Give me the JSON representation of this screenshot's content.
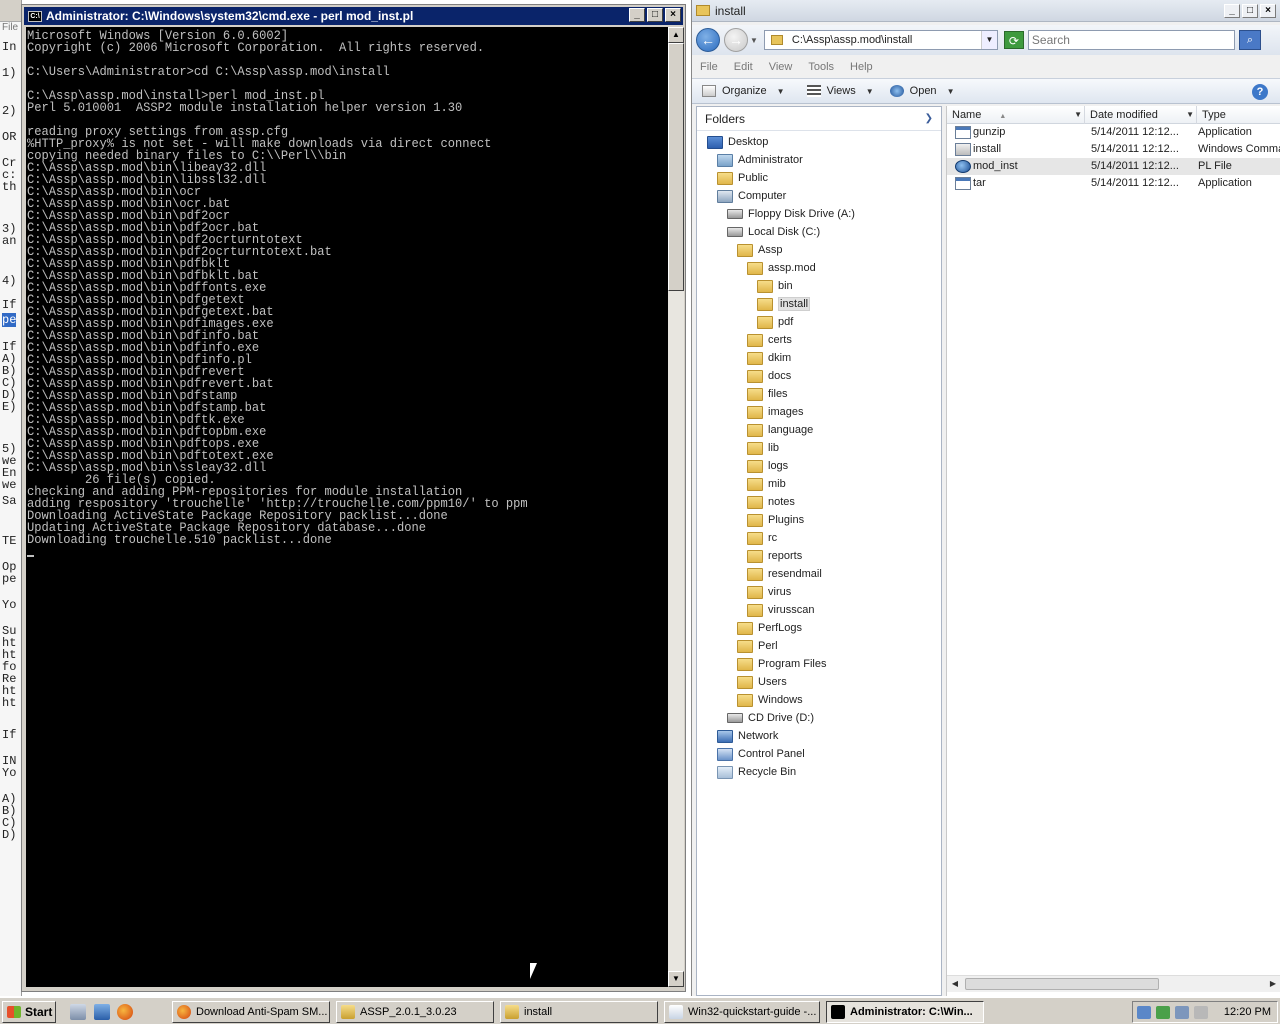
{
  "background_window": {
    "fragments": [
      "File",
      "In",
      "1)",
      "2)",
      "OR",
      "Cr",
      "c:",
      "th",
      "3)",
      "an",
      "4)",
      "If",
      "pe",
      "If",
      "A)",
      "B)",
      "C)",
      "D)",
      "E)",
      "5)",
      "we",
      "En",
      "we",
      "Sa",
      "TE",
      "Op",
      "pe",
      "Yo",
      "Su",
      "ht",
      "ht",
      "fo",
      "Re",
      "ht",
      "ht",
      "If",
      "IN",
      "Yo",
      "A)",
      "B)",
      "C)",
      "D)"
    ]
  },
  "cmd": {
    "title": "Administrator: C:\\Windows\\system32\\cmd.exe - perl  mod_inst.pl",
    "icon": "C:\\",
    "lines": [
      "Microsoft Windows [Version 6.0.6002]",
      "Copyright (c) 2006 Microsoft Corporation.  All rights reserved.",
      "",
      "C:\\Users\\Administrator>cd C:\\Assp\\assp.mod\\install",
      "",
      "C:\\Assp\\assp.mod\\install>perl mod_inst.pl",
      "Perl 5.010001  ASSP2 module installation helper version 1.30",
      "",
      "reading proxy settings from assp.cfg",
      "%HTTP_proxy% is not set - will make downloads via direct connect",
      "copying needed binary files to C:\\\\Perl\\\\bin",
      "C:\\Assp\\assp.mod\\bin\\libeay32.dll",
      "C:\\Assp\\assp.mod\\bin\\libssl32.dll",
      "C:\\Assp\\assp.mod\\bin\\ocr",
      "C:\\Assp\\assp.mod\\bin\\ocr.bat",
      "C:\\Assp\\assp.mod\\bin\\pdf2ocr",
      "C:\\Assp\\assp.mod\\bin\\pdf2ocr.bat",
      "C:\\Assp\\assp.mod\\bin\\pdf2ocrturntotext",
      "C:\\Assp\\assp.mod\\bin\\pdf2ocrturntotext.bat",
      "C:\\Assp\\assp.mod\\bin\\pdfbklt",
      "C:\\Assp\\assp.mod\\bin\\pdfbklt.bat",
      "C:\\Assp\\assp.mod\\bin\\pdffonts.exe",
      "C:\\Assp\\assp.mod\\bin\\pdfgetext",
      "C:\\Assp\\assp.mod\\bin\\pdfgetext.bat",
      "C:\\Assp\\assp.mod\\bin\\pdfimages.exe",
      "C:\\Assp\\assp.mod\\bin\\pdfinfo.bat",
      "C:\\Assp\\assp.mod\\bin\\pdfinfo.exe",
      "C:\\Assp\\assp.mod\\bin\\pdfinfo.pl",
      "C:\\Assp\\assp.mod\\bin\\pdfrevert",
      "C:\\Assp\\assp.mod\\bin\\pdfrevert.bat",
      "C:\\Assp\\assp.mod\\bin\\pdfstamp",
      "C:\\Assp\\assp.mod\\bin\\pdfstamp.bat",
      "C:\\Assp\\assp.mod\\bin\\pdftk.exe",
      "C:\\Assp\\assp.mod\\bin\\pdftopbm.exe",
      "C:\\Assp\\assp.mod\\bin\\pdftops.exe",
      "C:\\Assp\\assp.mod\\bin\\pdftotext.exe",
      "C:\\Assp\\assp.mod\\bin\\ssleay32.dll",
      "        26 file(s) copied.",
      "checking and adding PPM-repositories for module installation",
      "adding respository 'trouchelle' 'http://trouchelle.com/ppm10/' to ppm",
      "Downloading ActiveState Package Repository packlist...done",
      "Updating ActiveState Package Repository database...done",
      "Downloading trouchelle.510 packlist...done"
    ]
  },
  "explorer": {
    "title": "install",
    "address": "C:\\Assp\\assp.mod\\install",
    "search_placeholder": "Search",
    "menu": [
      "File",
      "Edit",
      "View",
      "Tools",
      "Help"
    ],
    "toolbar": {
      "organize": "Organize",
      "views": "Views",
      "open": "Open"
    },
    "folders_header": "Folders",
    "tree": [
      {
        "label": "Desktop",
        "icon": "desktop",
        "depth": 0
      },
      {
        "label": "Administrator",
        "icon": "user",
        "depth": 1
      },
      {
        "label": "Public",
        "icon": "folder",
        "depth": 1
      },
      {
        "label": "Computer",
        "icon": "computer",
        "depth": 1
      },
      {
        "label": "Floppy Disk Drive (A:)",
        "icon": "drive",
        "depth": 2
      },
      {
        "label": "Local Disk (C:)",
        "icon": "drive",
        "depth": 2
      },
      {
        "label": "Assp",
        "icon": "folder",
        "depth": 3
      },
      {
        "label": "assp.mod",
        "icon": "folder",
        "depth": 4
      },
      {
        "label": "bin",
        "icon": "folder",
        "depth": 5
      },
      {
        "label": "install",
        "icon": "folder",
        "depth": 5,
        "selected": true
      },
      {
        "label": "pdf",
        "icon": "folder",
        "depth": 5
      },
      {
        "label": "certs",
        "icon": "folder",
        "depth": 4
      },
      {
        "label": "dkim",
        "icon": "folder",
        "depth": 4
      },
      {
        "label": "docs",
        "icon": "folder",
        "depth": 4
      },
      {
        "label": "files",
        "icon": "folder",
        "depth": 4
      },
      {
        "label": "images",
        "icon": "folder",
        "depth": 4
      },
      {
        "label": "language",
        "icon": "folder",
        "depth": 4
      },
      {
        "label": "lib",
        "icon": "folder",
        "depth": 4
      },
      {
        "label": "logs",
        "icon": "folder",
        "depth": 4
      },
      {
        "label": "mib",
        "icon": "folder",
        "depth": 4
      },
      {
        "label": "notes",
        "icon": "folder",
        "depth": 4
      },
      {
        "label": "Plugins",
        "icon": "folder",
        "depth": 4
      },
      {
        "label": "rc",
        "icon": "folder",
        "depth": 4
      },
      {
        "label": "reports",
        "icon": "folder",
        "depth": 4
      },
      {
        "label": "resendmail",
        "icon": "folder",
        "depth": 4
      },
      {
        "label": "virus",
        "icon": "folder",
        "depth": 4
      },
      {
        "label": "virusscan",
        "icon": "folder",
        "depth": 4
      },
      {
        "label": "PerfLogs",
        "icon": "folder",
        "depth": 3
      },
      {
        "label": "Perl",
        "icon": "folder",
        "depth": 3
      },
      {
        "label": "Program Files",
        "icon": "folder",
        "depth": 3
      },
      {
        "label": "Users",
        "icon": "folder",
        "depth": 3
      },
      {
        "label": "Windows",
        "icon": "folder",
        "depth": 3
      },
      {
        "label": "CD Drive (D:)",
        "icon": "drive",
        "depth": 2
      },
      {
        "label": "Network",
        "icon": "network",
        "depth": 1
      },
      {
        "label": "Control Panel",
        "icon": "panel",
        "depth": 1
      },
      {
        "label": "Recycle Bin",
        "icon": "recycle",
        "depth": 1
      }
    ],
    "columns": {
      "name": "Name",
      "date": "Date modified",
      "type": "Type"
    },
    "files": [
      {
        "name": "gunzip",
        "date": "5/14/2011 12:12...",
        "type": "Application",
        "icon": "app"
      },
      {
        "name": "install",
        "date": "5/14/2011 12:12...",
        "type": "Windows Comma",
        "icon": "cmd"
      },
      {
        "name": "mod_inst",
        "date": "5/14/2011 12:12...",
        "type": "PL File",
        "icon": "pl",
        "selected": true
      },
      {
        "name": "tar",
        "date": "5/14/2011 12:12...",
        "type": "Application",
        "icon": "app"
      }
    ]
  },
  "taskbar": {
    "start": "Start",
    "buttons": [
      {
        "label": "Download Anti-Spam SM...",
        "icon": "firefox-icon",
        "active": false
      },
      {
        "label": "ASSP_2.0.1_3.0.23",
        "icon": "folder-zip-icon",
        "active": false
      },
      {
        "label": "install",
        "icon": "folder-zip-icon",
        "active": false
      },
      {
        "label": "Win32-quickstart-guide -...",
        "icon": "document-icon",
        "active": false
      },
      {
        "label": "Administrator: C:\\Win...",
        "icon": "cmd-icon",
        "active": true
      }
    ],
    "clock": "12:20 PM"
  }
}
